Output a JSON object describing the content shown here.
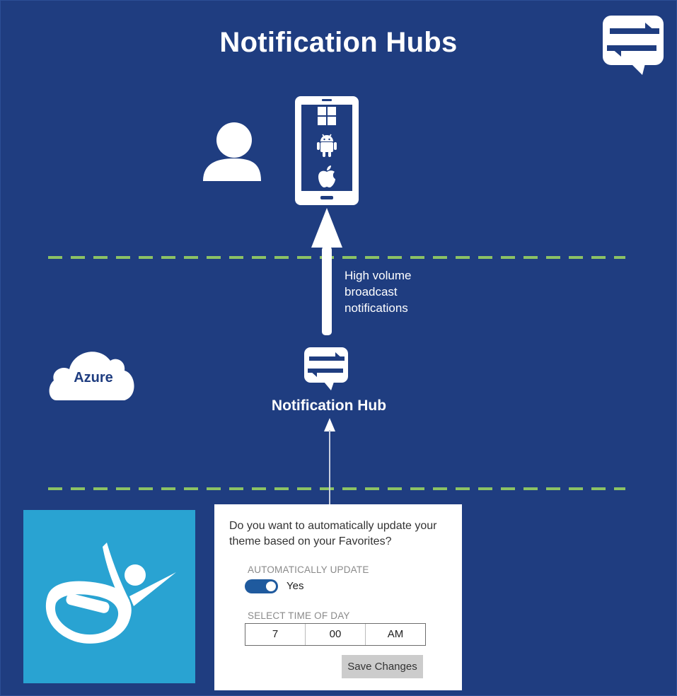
{
  "header": {
    "title": "Notification Hubs"
  },
  "icons": {
    "logo": "notification-hubs-logo-icon",
    "user": "user-icon",
    "phone": "smartphone-icon",
    "windows": "windows-icon",
    "android": "android-icon",
    "apple": "apple-icon",
    "arrow": "arrow-up-icon",
    "hub": "notification-hub-icon",
    "cloud": "cloud-icon",
    "app": "app-tile-icon"
  },
  "diagram": {
    "arrow_label": [
      "High volume",
      "broadcast",
      "notifications"
    ],
    "hub_label": "Notification Hub",
    "cloud_label": "Azure"
  },
  "settings_panel": {
    "question": "Do you want to automatically update your theme based on your Favorites?",
    "auto_update_label": "AUTOMATICALLY UPDATE",
    "toggle_state": "Yes",
    "time_label": "SELECT TIME OF DAY",
    "time": {
      "hour": "7",
      "minute": "00",
      "period": "AM"
    },
    "save_label": "Save Changes"
  },
  "colors": {
    "background": "#1f3d80",
    "dashed_line": "#8cc264",
    "tile": "#29a3d2",
    "toggle": "#1f5a9e",
    "button": "#cccccc"
  }
}
